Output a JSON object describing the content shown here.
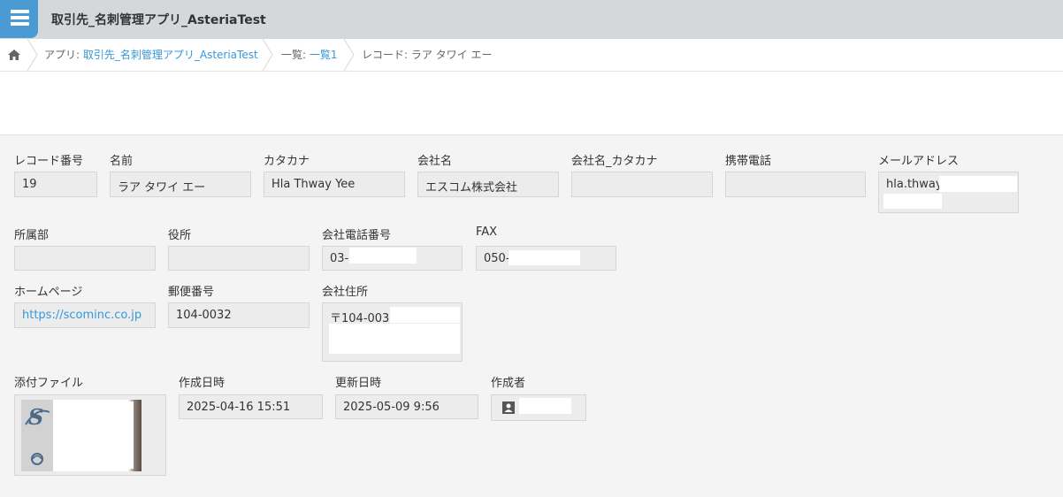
{
  "header": {
    "title": "取引先_名刺管理アプリ_AsteriaTest"
  },
  "breadcrumb": {
    "app_prefix": "アプリ: ",
    "app_name": "取引先_名刺管理アプリ_AsteriaTest",
    "list_prefix": "一覧: ",
    "list_name": "一覧1",
    "record": "レコード: ラア タワイ エー"
  },
  "fields": {
    "record_no": {
      "label": "レコード番号",
      "value": "19"
    },
    "name": {
      "label": "名前",
      "value": "ラア タワイ エー"
    },
    "kana": {
      "label": "カタカナ",
      "value": "Hla Thway Yee"
    },
    "company": {
      "label": "会社名",
      "value": "エスコム株式会社"
    },
    "company_kana": {
      "label": "会社名_カタカナ",
      "value": ""
    },
    "mobile": {
      "label": "携帯電話",
      "value": ""
    },
    "email": {
      "label": "メールアドレス",
      "value": "hla.thway."
    },
    "department": {
      "label": "所属部",
      "value": ""
    },
    "title": {
      "label": "役所",
      "value": ""
    },
    "phone": {
      "label": "会社電話番号",
      "value": "03-("
    },
    "fax": {
      "label": "FAX",
      "value": "050-"
    },
    "homepage": {
      "label": "ホームページ",
      "value": "https://scominc.co.jp"
    },
    "postal": {
      "label": "郵便番号",
      "value": "104-0032"
    },
    "address": {
      "label": "会社住所",
      "value": "〒104-0032"
    },
    "attachment": {
      "label": "添付ファイル"
    },
    "created": {
      "label": "作成日時",
      "value": "2025-04-16 15:51"
    },
    "updated": {
      "label": "更新日時",
      "value": "2025-05-09 9:56"
    },
    "creator": {
      "label": "作成者",
      "value": ""
    }
  }
}
